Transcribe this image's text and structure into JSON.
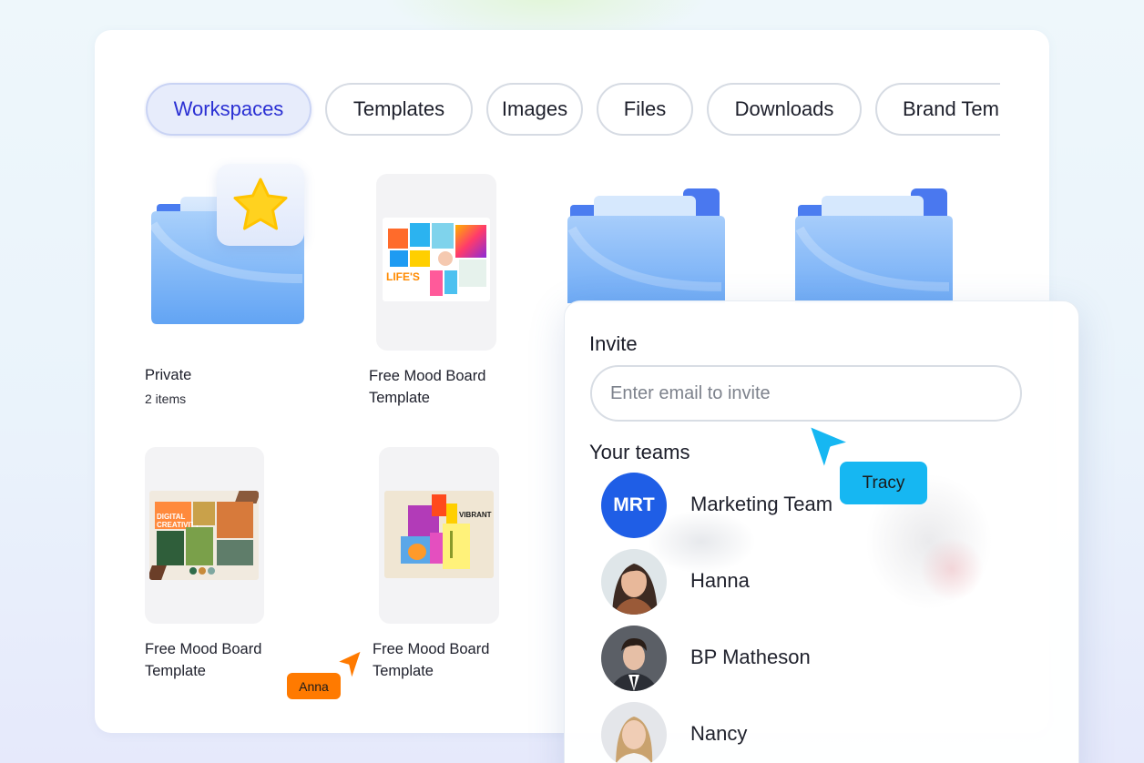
{
  "tabs": [
    {
      "label": "Workspaces",
      "active": true
    },
    {
      "label": "Templates",
      "active": false
    },
    {
      "label": "Images",
      "active": false
    },
    {
      "label": "Files",
      "active": false
    },
    {
      "label": "Downloads",
      "active": false
    },
    {
      "label": "Brand Temp",
      "active": false
    }
  ],
  "items": {
    "private": {
      "title": "Private",
      "sub": "2 items",
      "icon": "star-icon"
    },
    "mood1": {
      "title_line1": "Free Mood Board",
      "title_line2": "Template",
      "thumb_text": "LIFE'S"
    },
    "mood2": {
      "title_line1": "Free Mood Board",
      "title_line2": "Template",
      "thumb_text": "DIGITAL CREATIVITY"
    },
    "mood3": {
      "title_line1": "Free Mood Board",
      "title_line2": "Template",
      "thumb_text": "VIBRANT"
    }
  },
  "cursors": {
    "anna": {
      "label": "Anna",
      "color": "#ff7a00"
    },
    "tracy": {
      "label": "Tracy",
      "color": "#16b7f2"
    }
  },
  "invite": {
    "title": "Invite",
    "placeholder": "Enter email to invite",
    "teams_title": "Your teams",
    "members": [
      {
        "name": "Marketing Team",
        "initials": "MRT",
        "avatar_color": "#1f5ee6"
      },
      {
        "name": "Hanna",
        "avatar": "woman-avatar"
      },
      {
        "name": "BP Matheson",
        "avatar": "man-avatar"
      },
      {
        "name": "Nancy",
        "avatar": "woman-avatar"
      }
    ]
  },
  "colors": {
    "accent": "#2a2fd3",
    "folder": "#7cb6f6",
    "folder_dark": "#4a7ff0"
  }
}
